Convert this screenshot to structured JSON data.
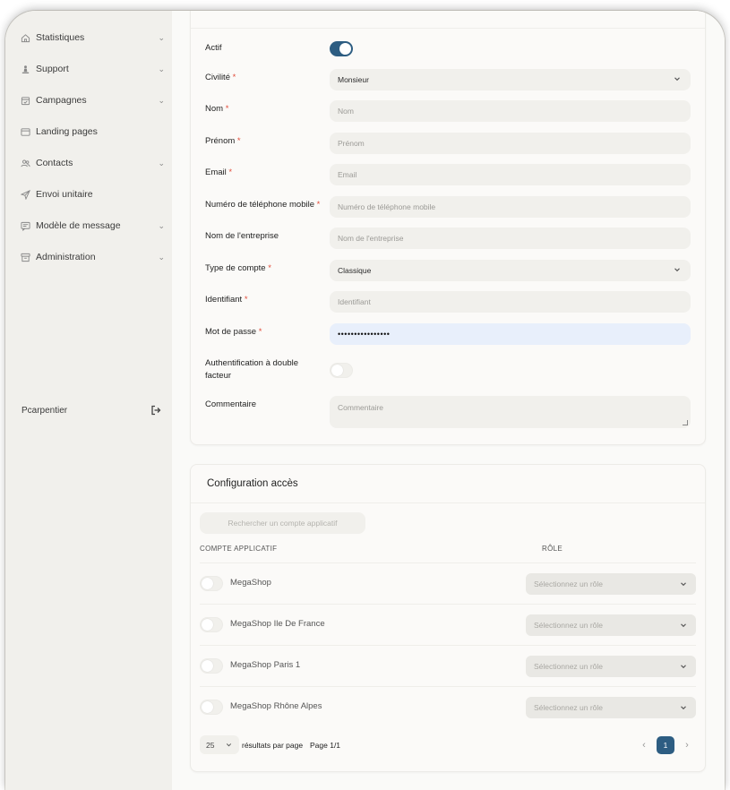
{
  "sidebar": {
    "items": [
      {
        "label": "Statistiques",
        "icon": "home-icon",
        "has_chevron": true
      },
      {
        "label": "Support",
        "icon": "support-icon",
        "has_chevron": true
      },
      {
        "label": "Campagnes",
        "icon": "calendar-icon",
        "has_chevron": true
      },
      {
        "label": "Landing pages",
        "icon": "window-icon",
        "has_chevron": false
      },
      {
        "label": "Contacts",
        "icon": "users-icon",
        "has_chevron": true
      },
      {
        "label": "Envoi unitaire",
        "icon": "send-icon",
        "has_chevron": false
      },
      {
        "label": "Modèle de message",
        "icon": "message-template-icon",
        "has_chevron": true
      },
      {
        "label": "Administration",
        "icon": "archive-icon",
        "has_chevron": true
      }
    ],
    "user": {
      "name": "Pcarpentier",
      "logout_icon": "logout-icon"
    }
  },
  "form": {
    "actif": {
      "label": "Actif",
      "value": true
    },
    "civilite": {
      "label": "Civilité",
      "required": "*",
      "value": "Monsieur"
    },
    "nom": {
      "label": "Nom",
      "required": "*",
      "placeholder": "Nom"
    },
    "prenom": {
      "label": "Prénom",
      "required": "*",
      "placeholder": "Prénom"
    },
    "email": {
      "label": "Email",
      "required": "*",
      "placeholder": "Email"
    },
    "mobile": {
      "label": "Numéro de téléphone mobile",
      "required": "*",
      "placeholder": "Numéro de téléphone mobile"
    },
    "entreprise": {
      "label": "Nom de l'entreprise",
      "placeholder": "Nom de l'entreprise"
    },
    "type_compte": {
      "label": "Type de compte",
      "required": "*",
      "value": "Classique"
    },
    "identifiant": {
      "label": "Identifiant",
      "required": "*",
      "placeholder": "Identifiant"
    },
    "mot_de_passe": {
      "label": "Mot de passe",
      "required": "*",
      "value": "••••••••••••••••"
    },
    "double_facteur": {
      "label_line1": "Authentification à double",
      "label_line2": "facteur",
      "value": false
    },
    "commentaire": {
      "label": "Commentaire",
      "placeholder": "Commentaire"
    }
  },
  "access": {
    "title": "Configuration accès",
    "search_label": "Rechercher un compte applicatif",
    "col_app": "COMPTE APPLICATIF",
    "col_role": "RÔLE",
    "rows": [
      {
        "name": "MegaShop",
        "role_placeholder": "Sélectionnez un rôle",
        "enabled": false
      },
      {
        "name": "MegaShop Ile De France",
        "role_placeholder": "Sélectionnez un rôle",
        "enabled": false
      },
      {
        "name": "MegaShop Paris 1",
        "role_placeholder": "Sélectionnez un rôle",
        "enabled": false
      },
      {
        "name": "MegaShop Rhône Alpes",
        "role_placeholder": "Sélectionnez un rôle",
        "enabled": false
      }
    ],
    "pagination": {
      "page_size": "25",
      "per_page_label": "résultats par page",
      "page_label": "Page 1/1",
      "current_page": "1",
      "prev_icon": "chevron-left-icon",
      "next_icon": "chevron-right-icon"
    }
  },
  "colors": {
    "accent": "#2d5d82",
    "required": "#e24d3b",
    "password_bg": "#e8effb"
  }
}
